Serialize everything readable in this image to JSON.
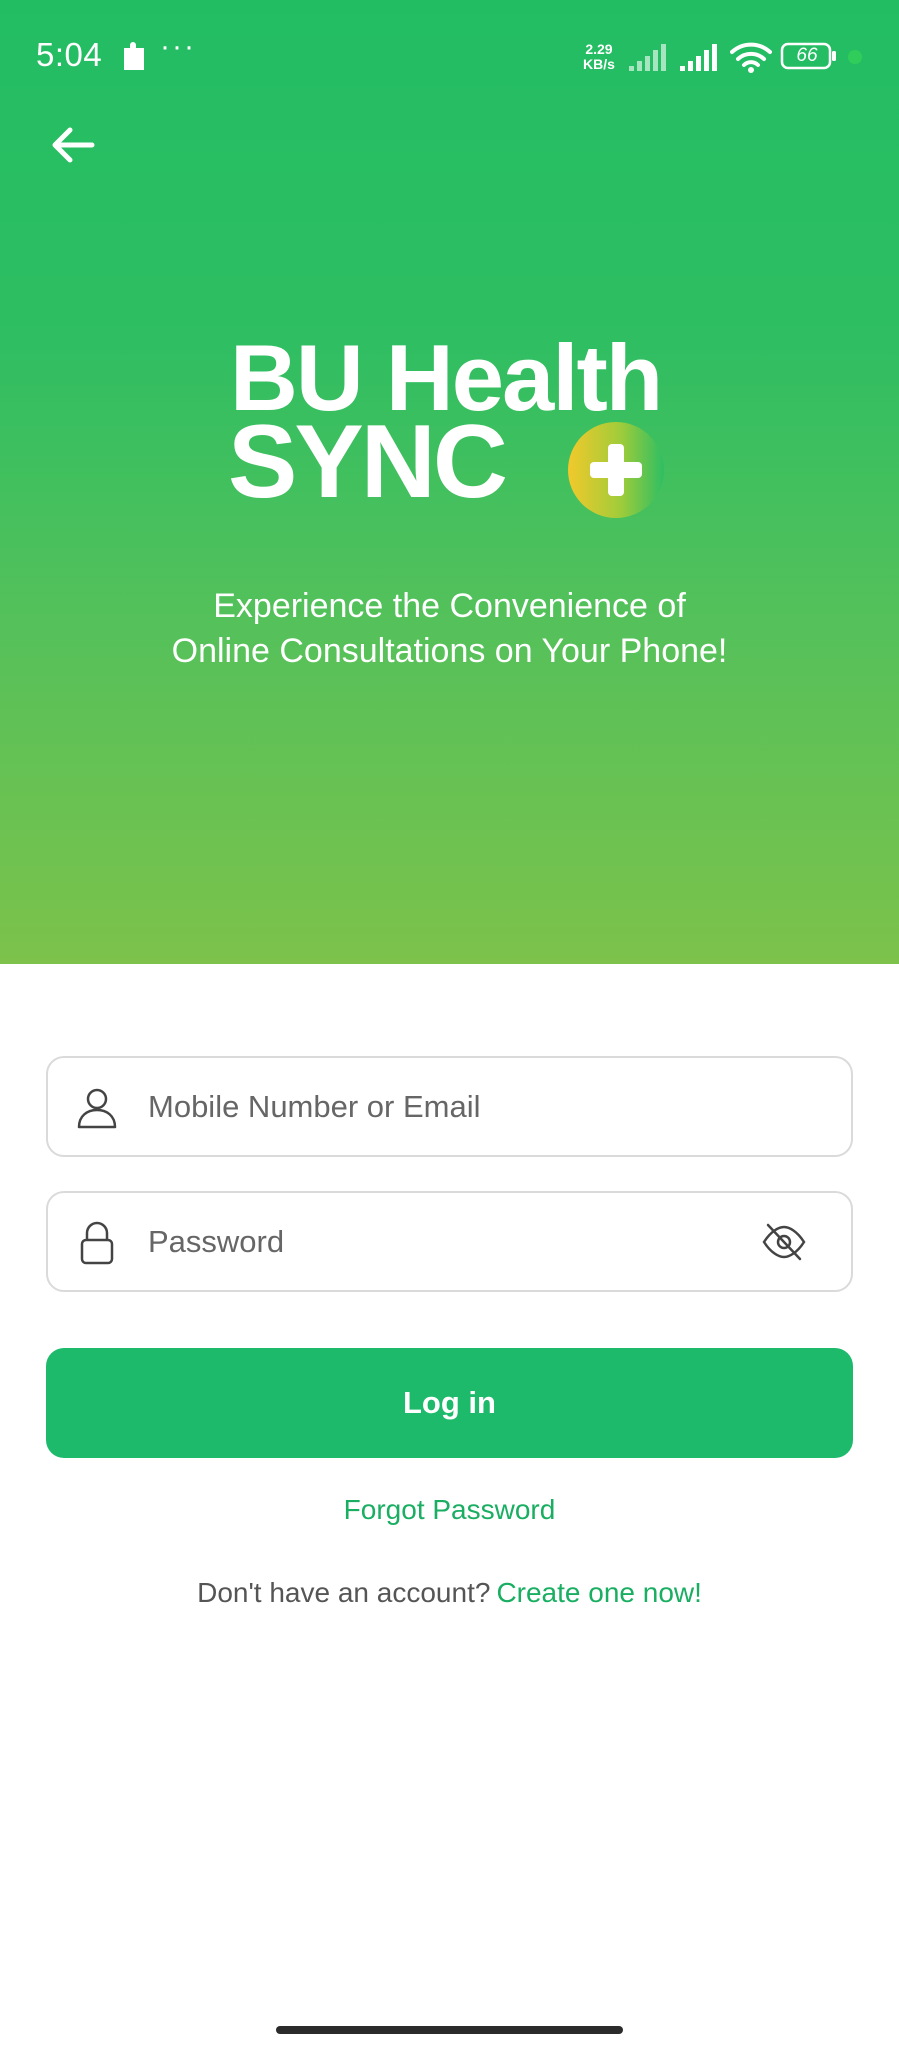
{
  "status_bar": {
    "time": "5:04",
    "dots": "···",
    "net_speed_value": "2.29",
    "net_speed_unit": "KB/s",
    "battery": "66"
  },
  "header": {
    "back_icon": "arrow-left-icon",
    "logo_line1": "BU Health",
    "logo_line2": "SYNC",
    "tagline_line1": "Experience the Convenience of",
    "tagline_line2": "Online Consultations on Your Phone!"
  },
  "form": {
    "email_placeholder": "Mobile Number or Email",
    "email_value": "",
    "email_icon": "user-icon",
    "password_placeholder": "Password",
    "password_value": "",
    "password_icon": "lock-icon",
    "visibility_icon": "eye-off-icon",
    "login_label": "Log in",
    "forgot_label": "Forgot Password",
    "signup_prompt": "Don't have an account?",
    "signup_link": "Create one now!"
  },
  "colors": {
    "brand_green": "#1dba6b",
    "hero_top": "#22bd63",
    "hero_bottom": "#7cc24b",
    "link_green": "#1aae62",
    "plus_yellow": "#f2c92b"
  }
}
